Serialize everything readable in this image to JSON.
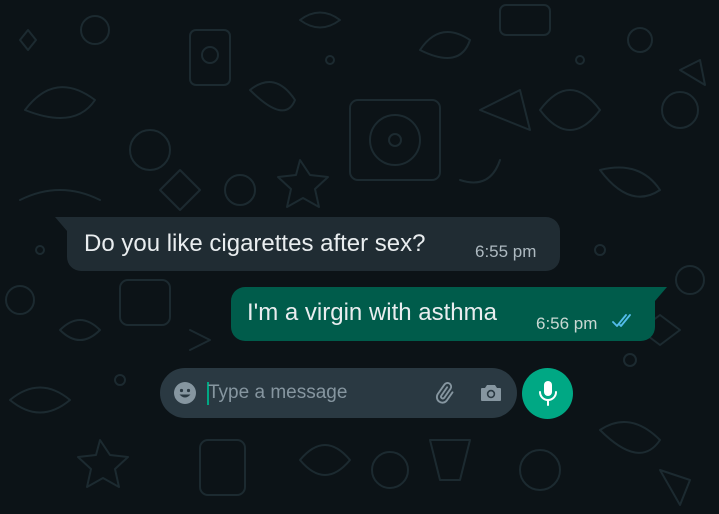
{
  "theme": {
    "background": "#0c1317",
    "incoming_bubble": "#202c33",
    "outgoing_bubble": "#005c4b",
    "input_background": "#2a3942",
    "accent": "#00a884",
    "read_ticks": "#53bdeb"
  },
  "messages": [
    {
      "direction": "incoming",
      "text": "Do you like cigarettes after sex?",
      "time": "6:55 pm"
    },
    {
      "direction": "outgoing",
      "text": "I'm a virgin with asthma",
      "time": "6:56 pm",
      "status": "read"
    }
  ],
  "composer": {
    "placeholder": "Type a message",
    "value": "",
    "icons": [
      "emoji-icon",
      "paperclip-icon",
      "camera-icon",
      "microphone-icon"
    ]
  }
}
